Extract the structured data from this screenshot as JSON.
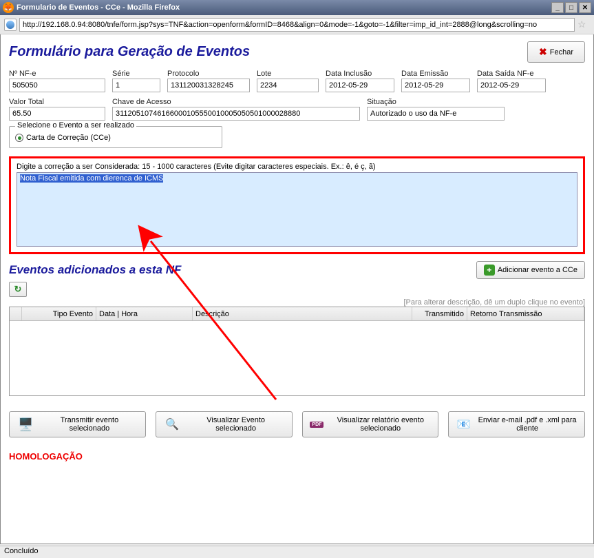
{
  "window": {
    "title": "Formulario de Eventos - CCe - Mozilla Firefox",
    "url": "http://192.168.0.94:8080/tnfe/form.jsp?sys=TNF&action=openform&formID=8468&align=0&mode=-1&goto=-1&filter=imp_id_int=2888@long&scrolling=no",
    "status": "Concluído"
  },
  "header": {
    "title": "Formulário para Geração de Eventos",
    "close_label": "Fechar"
  },
  "fields": {
    "nf": {
      "label": "Nº NF-e",
      "value": "505050"
    },
    "serie": {
      "label": "Série",
      "value": "1"
    },
    "protocolo": {
      "label": "Protocolo",
      "value": "131120031328245"
    },
    "lote": {
      "label": "Lote",
      "value": "2234"
    },
    "data_inclusao": {
      "label": "Data Inclusão",
      "value": "2012-05-29"
    },
    "data_emissao": {
      "label": "Data Emissão",
      "value": "2012-05-29"
    },
    "data_saida": {
      "label": "Data Saída NF-e",
      "value": "2012-05-29"
    },
    "valor_total": {
      "label": "Valor Total",
      "value": "65.50"
    },
    "chave": {
      "label": "Chave de Acesso",
      "value": "31120510746166000105550010005050501000028880"
    },
    "situacao": {
      "label": "Situação",
      "value": "Autorizado o uso da NF-e"
    }
  },
  "event_select": {
    "legend": "Selecione o Evento a ser realizado",
    "option": "Carta de Correção (CCe)"
  },
  "correction": {
    "label": "Digite a correção a ser Considerada: 15 - 1000 caracteres (Evite digitar caracteres especiais. Ex.: ê, é ç, ã)",
    "value": "Nota Fiscal emitida com dierenca de ICMS"
  },
  "events_section": {
    "title": "Eventos adicionados a esta NF",
    "add_label": "Adicionar evento a CCe",
    "hint": "[Para alterar descrição, dê um duplo clique no evento]",
    "columns": {
      "tipo": "Tipo Evento",
      "data": "Data | Hora",
      "descricao": "Descrição",
      "transmitido": "Transmitido",
      "retorno": "Retorno Transmissão"
    }
  },
  "actions": {
    "transmitir": "Transmitir evento selecionado",
    "visualizar_evento": "Visualizar Evento selecionado",
    "visualizar_relatorio": "Visualizar relatório evento selecionado",
    "enviar_email": "Enviar e-mail .pdf e .xml para cliente"
  },
  "footer": {
    "homolog": "HOMOLOGAÇÃO"
  }
}
